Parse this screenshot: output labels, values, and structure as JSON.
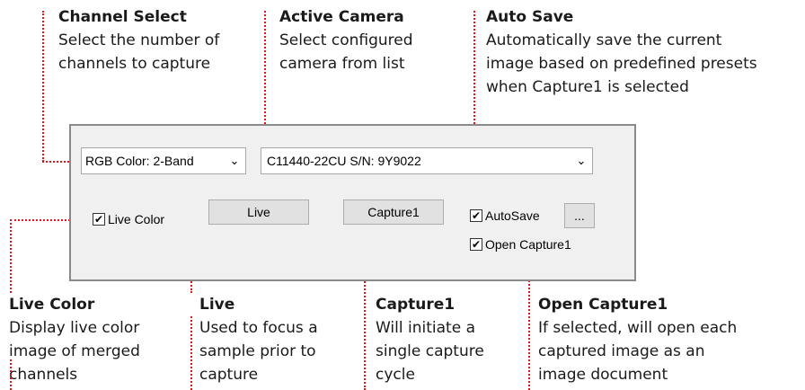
{
  "callouts": {
    "channel_select": {
      "title": "Channel Select",
      "desc": "Select the number of\nchannels to capture"
    },
    "active_camera": {
      "title": "Active Camera",
      "desc": "Select configured\ncamera from list"
    },
    "auto_save": {
      "title": "Auto Save",
      "desc": "Automatically save the current\nimage based on predefined presets\nwhen Capture1 is selected"
    },
    "live_color": {
      "title": "Live Color",
      "desc": "Display live color\nimage of merged\nchannels"
    },
    "live": {
      "title": "Live",
      "desc": "Used to focus a\nsample prior to\ncapture"
    },
    "capture1": {
      "title": "Capture1",
      "desc": "Will initiate a\nsingle capture\ncycle"
    },
    "open_capture1": {
      "title": "Open Capture1",
      "desc": "If selected, will open each\ncaptured image as an\nimage document"
    }
  },
  "panel": {
    "channel_select": {
      "value": "RGB Color: 2-Band",
      "arrow": "⌄"
    },
    "camera_select": {
      "value": "C11440-22CU S/N: 9Y9022",
      "arrow": "⌄"
    },
    "live_color": {
      "label": "Live Color",
      "checked": "✔"
    },
    "live_button": {
      "label": "Live"
    },
    "capture_button": {
      "label": "Capture1"
    },
    "autosave": {
      "label": "AutoSave",
      "checked": "✔"
    },
    "autosave_options": {
      "label": "..."
    },
    "open_capture": {
      "label": "Open Capture1",
      "checked": "✔"
    }
  },
  "colors": {
    "callout_line": "#e8141c",
    "panel_bg": "#f0f0f0"
  }
}
